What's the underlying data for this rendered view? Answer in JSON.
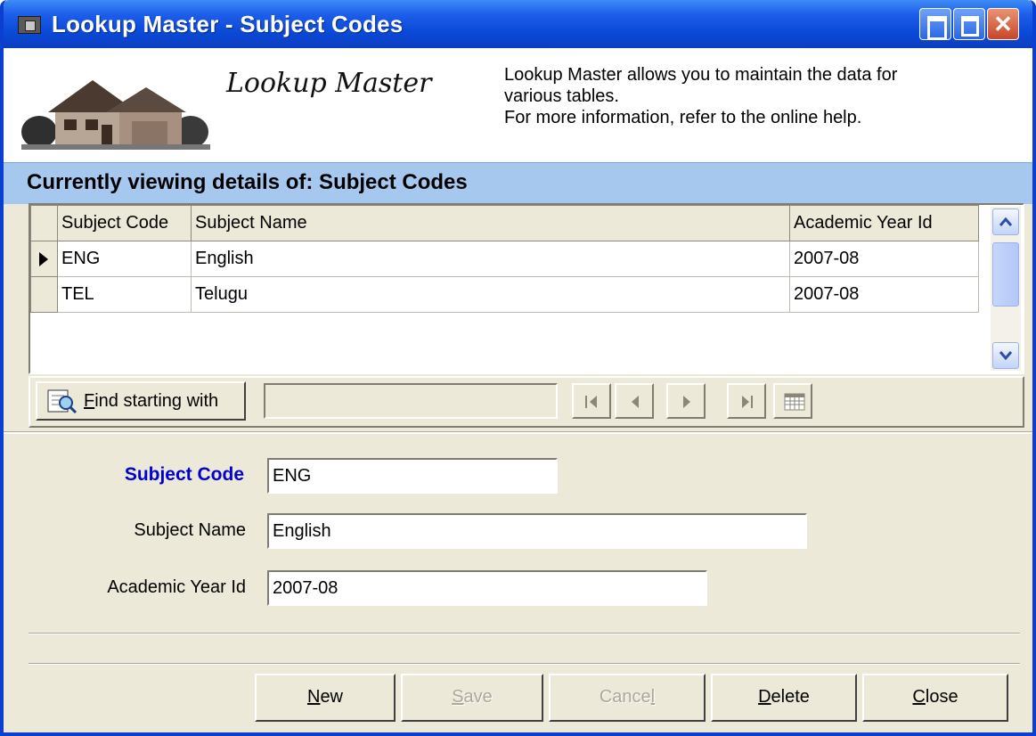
{
  "window": {
    "title": "Lookup Master - Subject Codes"
  },
  "header": {
    "brand": "Lookup Master",
    "info_line1": "Lookup Master allows you to maintain the data for",
    "info_line2": "various tables.",
    "info_line3": "For more information, refer to the online help."
  },
  "section": {
    "viewing": "Currently viewing details of: Subject Codes"
  },
  "grid": {
    "columns": [
      "Subject Code",
      "Subject Name",
      "Academic Year Id"
    ],
    "rows": [
      [
        "ENG",
        "English",
        "2007-08"
      ],
      [
        "TEL",
        "Telugu",
        "2007-08"
      ]
    ]
  },
  "toolbar": {
    "find_label_prefix": "F",
    "find_label_rest": "ind starting with",
    "find_value": ""
  },
  "form": {
    "subject_code_label": "Subject Code",
    "subject_code_value": "ENG",
    "subject_name_label": "Subject Name",
    "subject_name_value": "English",
    "academic_year_label": "Academic Year Id",
    "academic_year_value": "2007-08"
  },
  "buttons": {
    "new_u": "N",
    "new_rest": "ew",
    "save_u": "S",
    "save_rest": "ave",
    "cancel_pre": "Cance",
    "cancel_u": "l",
    "delete_u": "D",
    "delete_rest": "elete",
    "close_u": "C",
    "close_rest": "lose"
  }
}
